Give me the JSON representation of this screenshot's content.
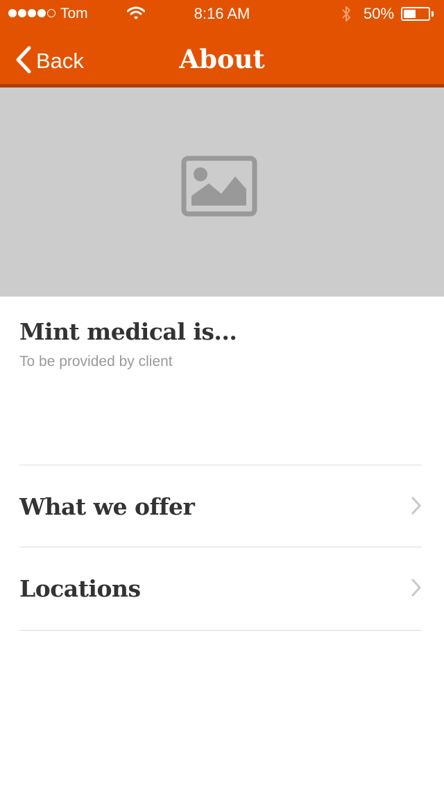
{
  "status_bar": {
    "carrier": "Tom",
    "time": "8:16 AM",
    "battery_percent": "50%",
    "battery_level": 0.5,
    "signal_bars": 4,
    "signal_total": 5,
    "icons": [
      "signal-dots-icon",
      "wifi-icon",
      "bluetooth-icon",
      "battery-icon"
    ]
  },
  "nav": {
    "back_label": "Back",
    "title": "About",
    "icons": [
      "chevron-left-icon"
    ]
  },
  "hero": {
    "icon": "image-placeholder-icon"
  },
  "intro": {
    "title": "Mint medical is...",
    "subtitle": "To be provided by client"
  },
  "menu": {
    "items": [
      {
        "label": "What we offer",
        "icon": "chevron-right-icon"
      },
      {
        "label": "Locations",
        "icon": "chevron-right-icon"
      }
    ]
  },
  "colors": {
    "brand": "#e35200",
    "brand_dark": "#b03d00",
    "hero_bg": "#cccccc",
    "text": "#333333",
    "muted": "#999999",
    "divider": "#dddddd"
  }
}
